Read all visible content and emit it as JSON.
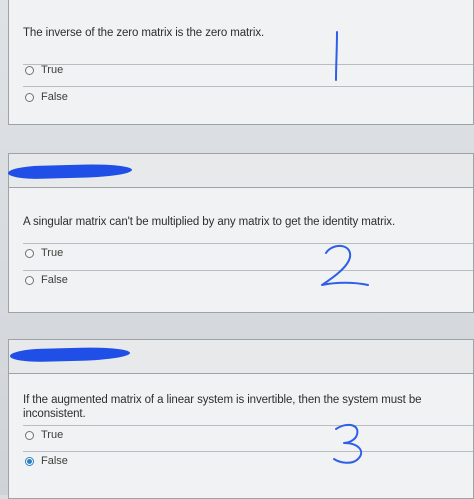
{
  "questions": [
    {
      "text": "The inverse of the zero matrix is the zero matrix.",
      "options": [
        {
          "label": "True",
          "selected": false
        },
        {
          "label": "False",
          "selected": false
        }
      ],
      "handwritten_number": "1"
    },
    {
      "text": "A singular matrix can't be multiplied by any matrix to get the identity matrix.",
      "options": [
        {
          "label": "True",
          "selected": false
        },
        {
          "label": "False",
          "selected": false
        }
      ],
      "handwritten_number": "2"
    },
    {
      "text": "If the augmented matrix of a linear system is invertible, then the system must be inconsistent.",
      "options": [
        {
          "label": "True",
          "selected": false
        },
        {
          "label": "False",
          "selected": true
        }
      ],
      "handwritten_number": "3"
    }
  ],
  "colors": {
    "radio_selected": "#2a7fc8",
    "redaction": "#1f4fe6",
    "handwriting": "#2f5fe8"
  }
}
